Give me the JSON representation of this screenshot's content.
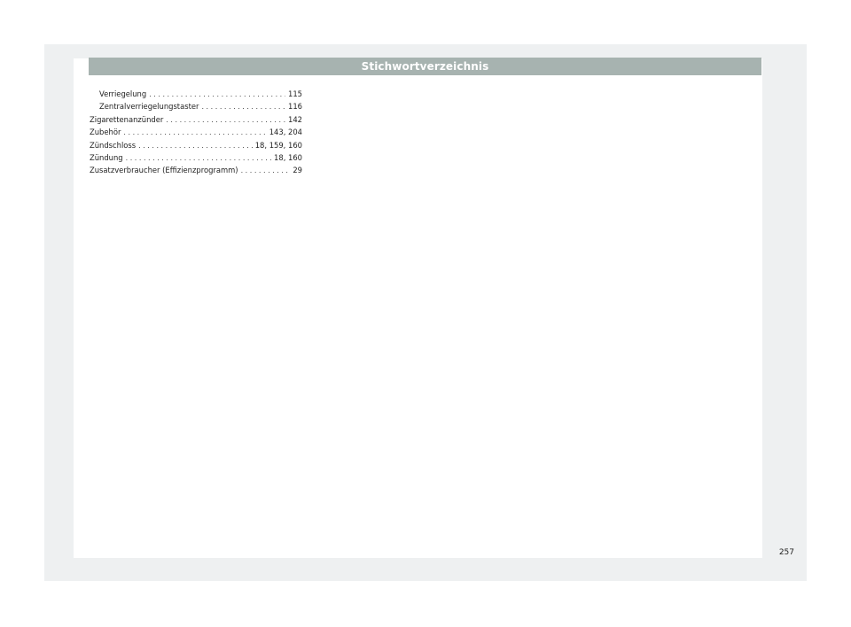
{
  "header": {
    "title": "Stichwortverzeichnis"
  },
  "index": {
    "entries": [
      {
        "term": "Verriegelung",
        "pages": "115",
        "level": 2
      },
      {
        "term": "Zentralverriegelungstaster",
        "pages": "116",
        "level": 2
      },
      {
        "term": "Zigarettenanzünder",
        "pages": "142",
        "level": 1
      },
      {
        "term": "Zubehör",
        "pages": "143, 204",
        "level": 1
      },
      {
        "term": "Zündschloss",
        "pages": "18, 159, 160",
        "level": 1
      },
      {
        "term": "Zündung",
        "pages": "18, 160",
        "level": 1
      },
      {
        "term": "Zusatzverbraucher (Effizienzprogramm)",
        "pages": "29",
        "level": 1
      }
    ]
  },
  "footer": {
    "page_number": "257"
  },
  "colors": {
    "header_bar": "#a7b3b0",
    "frame": "#eef0f1",
    "text": "#222222"
  }
}
